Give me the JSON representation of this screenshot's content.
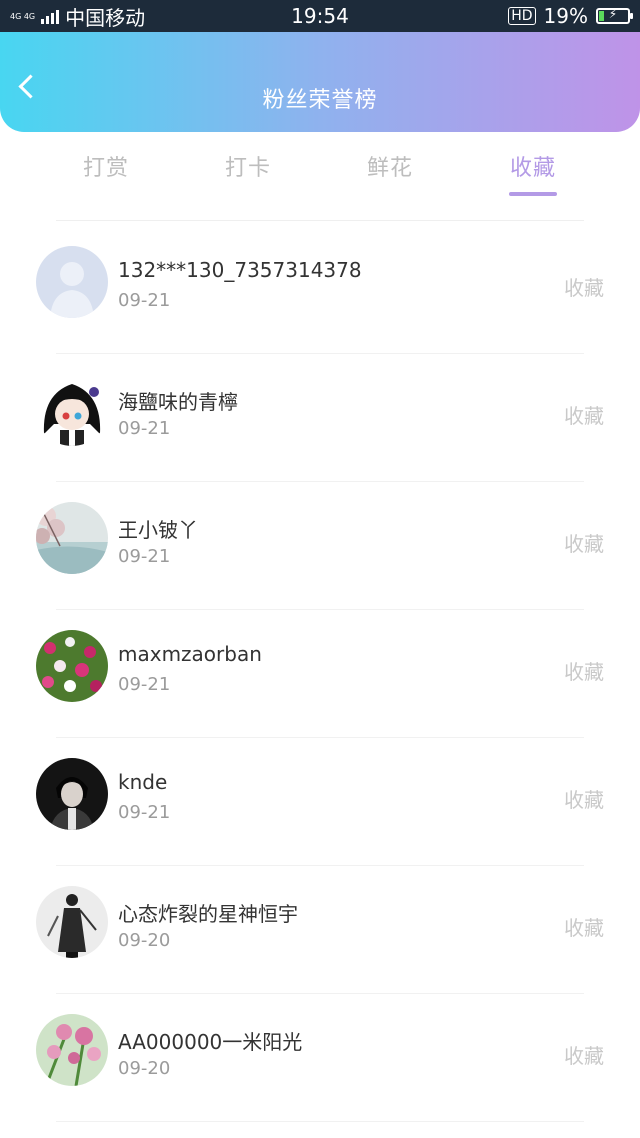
{
  "status_bar": {
    "network_top": "4G 4G",
    "carrier": "中国移动",
    "time": "19:54",
    "hd_label": "HD",
    "battery": "19%",
    "battery_level": 0.19
  },
  "header": {
    "title": "粉丝荣誉榜",
    "gradient_start": "#48d6f1",
    "gradient_end": "#bf93e8"
  },
  "tabs": [
    {
      "label": "打赏",
      "active": false
    },
    {
      "label": "打卡",
      "active": false
    },
    {
      "label": "鲜花",
      "active": false
    },
    {
      "label": "收藏",
      "active": true
    }
  ],
  "list": [
    {
      "name": "132***130_7357314378",
      "date": "09-21",
      "action": "收藏",
      "avatar": "default-person-avatar"
    },
    {
      "name": "海鹽味的青檸",
      "date": "09-21",
      "action": "收藏",
      "avatar": "anime-girl-avatar"
    },
    {
      "name": "王小铍丫",
      "date": "09-21",
      "action": "收藏",
      "avatar": "blossom-landscape-avatar"
    },
    {
      "name": "maxmzaorban",
      "date": "09-21",
      "action": "收藏",
      "avatar": "flowers-avatar"
    },
    {
      "name": "knde",
      "date": "09-21",
      "action": "收藏",
      "avatar": "dark-portrait-avatar"
    },
    {
      "name": "心态炸裂的星神恒宇",
      "date": "09-20",
      "action": "收藏",
      "avatar": "ink-figure-avatar"
    },
    {
      "name": "AA000000一米阳光",
      "date": "09-20",
      "action": "收藏",
      "avatar": "pink-flowers-avatar"
    }
  ],
  "colors": {
    "accent": "#b39ae6",
    "tab_inactive": "#bdbdbd",
    "action_text": "#c9c9c9"
  }
}
